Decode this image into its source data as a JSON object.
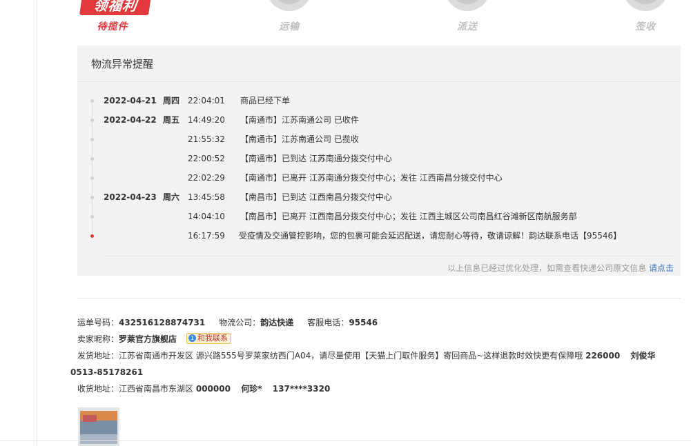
{
  "steps": {
    "badge": "领福利",
    "pending": "待揽件",
    "transport": "运输",
    "delivery": "派送",
    "signed": "签收"
  },
  "panel": {
    "title": "物流异常提醒",
    "events": [
      {
        "date": "2022-04-21",
        "weekday": "周四",
        "time": "22:04:01",
        "message": "商品已经下单"
      },
      {
        "date": "2022-04-22",
        "weekday": "周五",
        "time": "14:49:20",
        "message": "【南通市】江苏南通公司 已收件"
      },
      {
        "date": "",
        "weekday": "",
        "time": "21:55:32",
        "message": "【南通市】江苏南通公司 已揽收"
      },
      {
        "date": "",
        "weekday": "",
        "time": "22:00:52",
        "message": "【南通市】已到达 江苏南通分拨交付中心"
      },
      {
        "date": "",
        "weekday": "",
        "time": "22:02:29",
        "message": "【南通市】已离开 江苏南通分拨交付中心；发往 江西南昌分拨交付中心"
      },
      {
        "date": "2022-04-23",
        "weekday": "周六",
        "time": "13:45:58",
        "message": "【南昌市】已到达 江西南昌分拨交付中心"
      },
      {
        "date": "",
        "weekday": "",
        "time": "14:04:10",
        "message": "【南昌市】已离开 江西南昌分拨交付中心；发往 江西主城区公司南昌红谷滩新区南航服务部"
      },
      {
        "date": "",
        "weekday": "",
        "time": "16:17:59",
        "message": "受疫情及交通管控影响，您的包裹可能会延迟配送，请您耐心等待，敬请谅解！韵达联系电话【95546】"
      }
    ],
    "footer_text": "以上信息已经过优化处理，如需查看快递公司原文信息",
    "footer_link": "请点击"
  },
  "info": {
    "tracking_label": "运单号码：",
    "tracking_no": "432516128874731",
    "company_label": "物流公司：",
    "company": "韵达快递",
    "phone_label": "客服电话：",
    "phone": "95546",
    "seller_label": "卖家昵称：",
    "seller": "罗莱官方旗舰店",
    "contact_btn": "和我联系",
    "ship_label": "发货地址：",
    "ship_addr": "江苏省南通市开发区 源兴路555号罗莱家纺西门A04，请尽量使用【天猫上门取件服务】寄回商品~这样退款时效快更有保障哦",
    "ship_zip": "226000",
    "ship_name": "刘俊华",
    "ship_phone": "0513-85178261",
    "recv_label": "收货地址：",
    "recv_addr": "江西省南昌市东湖区",
    "recv_zip": "000000",
    "recv_name": "何珍*",
    "recv_phone": "137****3320"
  }
}
